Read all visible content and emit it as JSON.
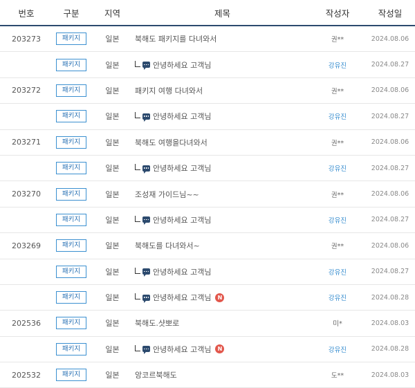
{
  "table": {
    "headers": {
      "num": "번호",
      "type": "구분",
      "region": "지역",
      "title": "제목",
      "author": "작성자",
      "date": "작성일"
    },
    "new_label": "N",
    "rows": [
      {
        "num": "203273",
        "type": "패키지",
        "region": "일본",
        "title": "북해도 패키지를 다녀와서",
        "author": "권**",
        "date": "2024.08.06",
        "reply": false,
        "new": false,
        "staff": false
      },
      {
        "num": "",
        "type": "패키지",
        "region": "일본",
        "title": "안녕하세요 고객님",
        "author": "강유진",
        "date": "2024.08.27",
        "reply": true,
        "new": false,
        "staff": true
      },
      {
        "num": "203272",
        "type": "패키지",
        "region": "일본",
        "title": "패키지 여행 다녀와서",
        "author": "권**",
        "date": "2024.08.06",
        "reply": false,
        "new": false,
        "staff": false
      },
      {
        "num": "",
        "type": "패키지",
        "region": "일본",
        "title": "안녕하세요 고객님",
        "author": "강유진",
        "date": "2024.08.27",
        "reply": true,
        "new": false,
        "staff": true
      },
      {
        "num": "203271",
        "type": "패키지",
        "region": "일본",
        "title": "북해도 여행을다녀와서",
        "author": "권**",
        "date": "2024.08.06",
        "reply": false,
        "new": false,
        "staff": false
      },
      {
        "num": "",
        "type": "패키지",
        "region": "일본",
        "title": "안녕하세요 고객님",
        "author": "강유진",
        "date": "2024.08.27",
        "reply": true,
        "new": false,
        "staff": true
      },
      {
        "num": "203270",
        "type": "패키지",
        "region": "일본",
        "title": "조성재 가이드님~~",
        "author": "권**",
        "date": "2024.08.06",
        "reply": false,
        "new": false,
        "staff": false
      },
      {
        "num": "",
        "type": "패키지",
        "region": "일본",
        "title": "안녕하세요 고객님",
        "author": "강유진",
        "date": "2024.08.27",
        "reply": true,
        "new": false,
        "staff": true
      },
      {
        "num": "203269",
        "type": "패키지",
        "region": "일본",
        "title": "북해도를 다녀와서~",
        "author": "권**",
        "date": "2024.08.06",
        "reply": false,
        "new": false,
        "staff": false
      },
      {
        "num": "",
        "type": "패키지",
        "region": "일본",
        "title": "안녕하세요 고객님",
        "author": "강유진",
        "date": "2024.08.27",
        "reply": true,
        "new": false,
        "staff": true
      },
      {
        "num": "",
        "type": "패키지",
        "region": "일본",
        "title": "안녕하세요 고객님",
        "author": "강유진",
        "date": "2024.08.28",
        "reply": true,
        "new": true,
        "staff": true
      },
      {
        "num": "202536",
        "type": "패키지",
        "region": "일본",
        "title": "북해도.샷뽀로",
        "author": "미*",
        "date": "2024.08.03",
        "reply": false,
        "new": false,
        "staff": false
      },
      {
        "num": "",
        "type": "패키지",
        "region": "일본",
        "title": "안녕하세요 고객님",
        "author": "강유진",
        "date": "2024.08.28",
        "reply": true,
        "new": true,
        "staff": true
      },
      {
        "num": "202532",
        "type": "패키지",
        "region": "일본",
        "title": "앙코르북해도",
        "author": "도**",
        "date": "2024.08.03",
        "reply": false,
        "new": false,
        "staff": false
      }
    ]
  }
}
